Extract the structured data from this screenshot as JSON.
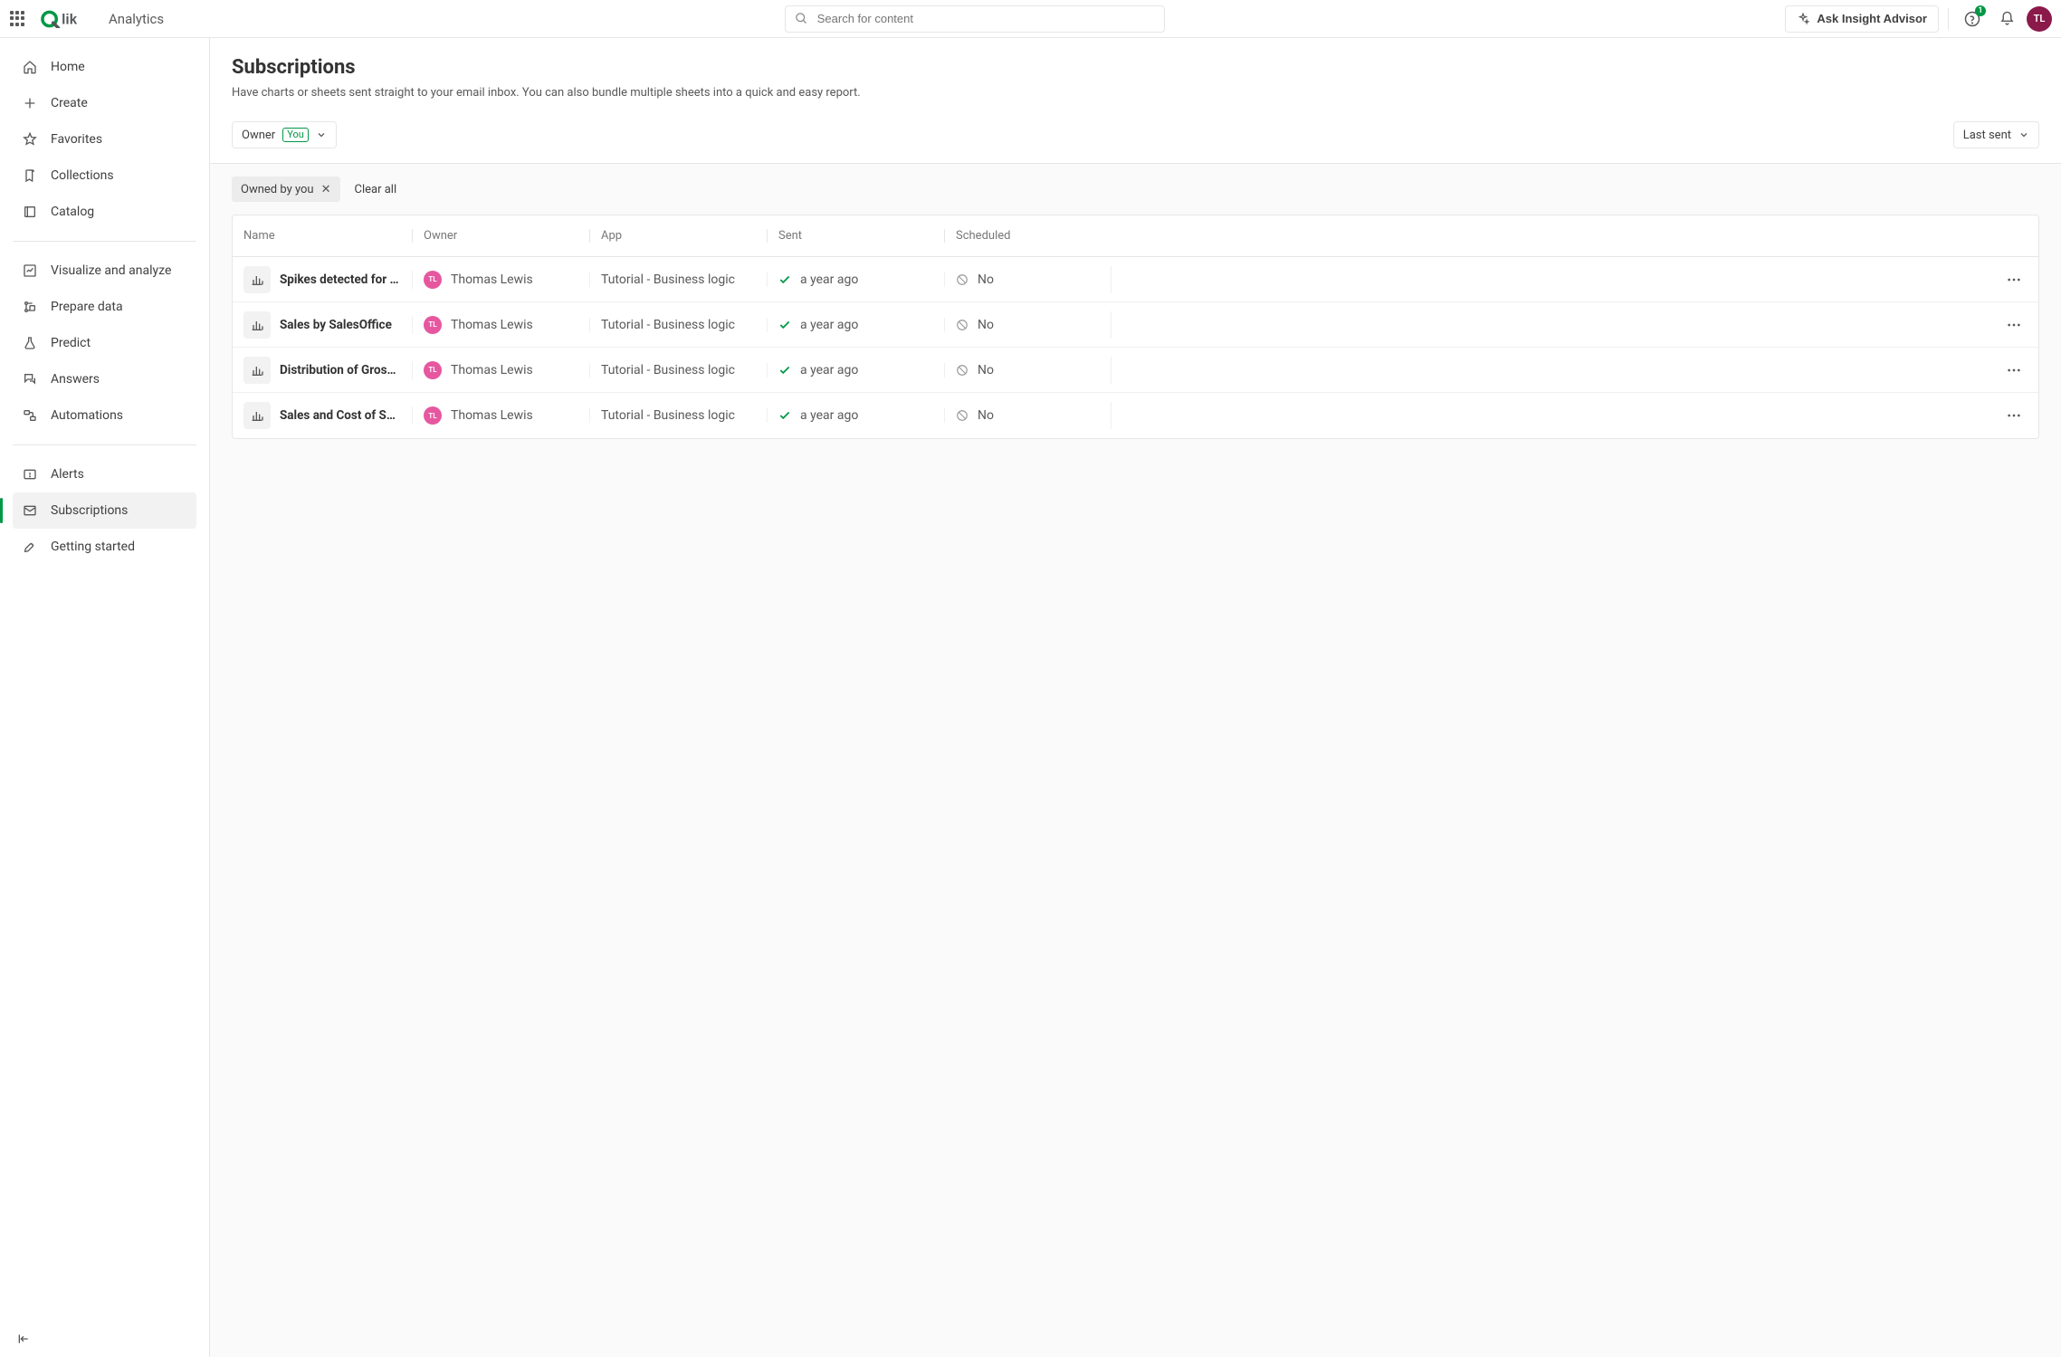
{
  "header": {
    "hub_name": "Analytics",
    "search_placeholder": "Search for content",
    "ask_label": "Ask Insight Advisor",
    "help_badge": "1",
    "avatar_initials": "TL"
  },
  "sidebar": {
    "items": [
      {
        "label": "Home",
        "icon": "home"
      },
      {
        "label": "Create",
        "icon": "plus"
      },
      {
        "label": "Favorites",
        "icon": "star"
      },
      {
        "label": "Collections",
        "icon": "bookmark"
      },
      {
        "label": "Catalog",
        "icon": "catalog"
      }
    ],
    "items2": [
      {
        "label": "Visualize and analyze",
        "icon": "viz"
      },
      {
        "label": "Prepare data",
        "icon": "prep"
      },
      {
        "label": "Predict",
        "icon": "flask"
      },
      {
        "label": "Answers",
        "icon": "answers"
      },
      {
        "label": "Automations",
        "icon": "auto"
      }
    ],
    "items3": [
      {
        "label": "Alerts",
        "icon": "alert"
      },
      {
        "label": "Subscriptions",
        "icon": "mail",
        "active": true
      },
      {
        "label": "Getting started",
        "icon": "rocket"
      }
    ]
  },
  "page": {
    "title": "Subscriptions",
    "description": "Have charts or sheets sent straight to your email inbox. You can also bundle multiple sheets into a quick and easy report.",
    "filter_label": "Owner",
    "filter_value": "You",
    "sort_label": "Last sent",
    "chip_label": "Owned by you",
    "clear_all_label": "Clear all"
  },
  "table": {
    "columns": {
      "name": "Name",
      "owner": "Owner",
      "app": "App",
      "sent": "Sent",
      "scheduled": "Scheduled"
    },
    "rows": [
      {
        "name": "Spikes detected for Cos…",
        "owner": "Thomas Lewis",
        "owner_initials": "TL",
        "app": "Tutorial - Business logic",
        "sent": "a year ago",
        "scheduled": "No"
      },
      {
        "name": "Sales by SalesOffice",
        "owner": "Thomas Lewis",
        "owner_initials": "TL",
        "app": "Tutorial - Business logic",
        "sent": "a year ago",
        "scheduled": "No"
      },
      {
        "name": "Distribution of Gross Pr…",
        "owner": "Thomas Lewis",
        "owner_initials": "TL",
        "app": "Tutorial - Business logic",
        "sent": "a year ago",
        "scheduled": "No"
      },
      {
        "name": "Sales and Cost of Sale …",
        "owner": "Thomas Lewis",
        "owner_initials": "TL",
        "app": "Tutorial - Business logic",
        "sent": "a year ago",
        "scheduled": "No"
      }
    ]
  }
}
